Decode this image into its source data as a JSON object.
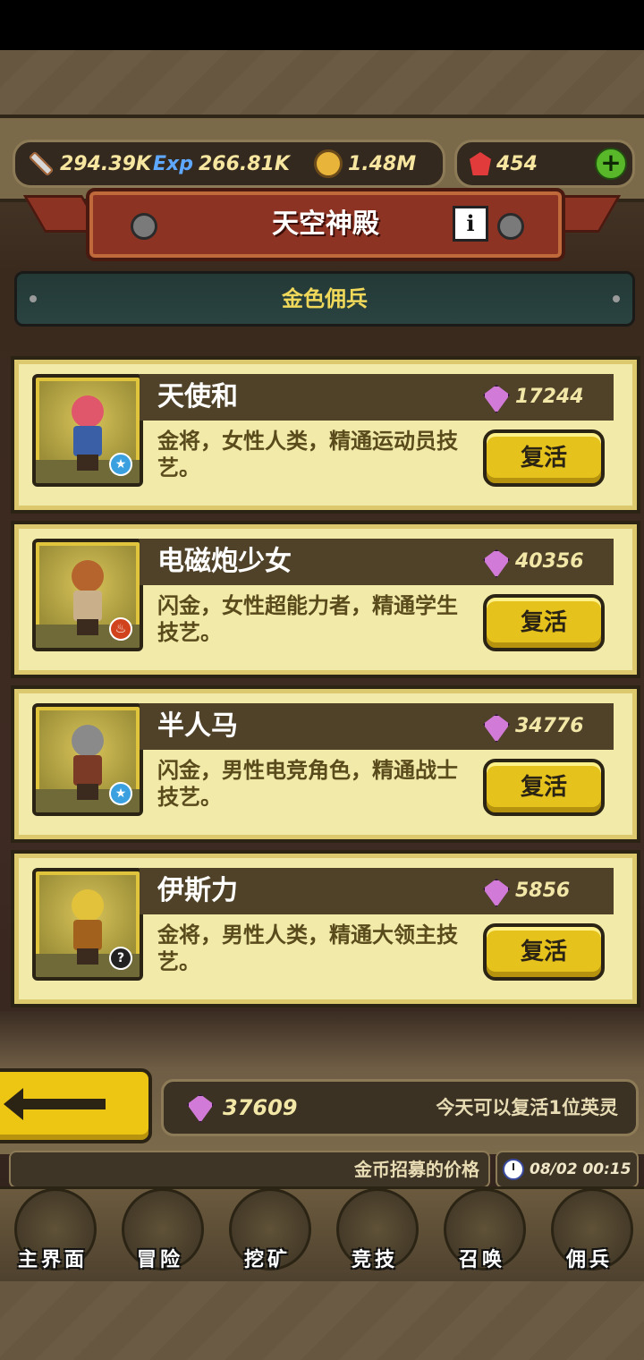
{
  "resources": {
    "power": "294.39K",
    "exp": "266.81K",
    "gold": "1.48M",
    "rubies": "454",
    "exp_icon_text": "Exp"
  },
  "header": {
    "title": "天空神殿",
    "info_label": "i"
  },
  "category": "金色佣兵",
  "heroes": [
    {
      "name": "天使和",
      "price": "17244",
      "desc": "金将，女性人类，精通运动员技艺。",
      "action": "复活",
      "badge": "★",
      "hair": "#e0566a",
      "outfit": "#3b5fa6",
      "badge_color": "#3aa0e0"
    },
    {
      "name": "电磁炮少女",
      "price": "40356",
      "desc": "闪金，女性超能力者，精通学生技艺。",
      "action": "复活",
      "badge": "♨",
      "hair": "#b4642c",
      "outfit": "#c9b08a",
      "badge_color": "#d0431d"
    },
    {
      "name": "半人马",
      "price": "34776",
      "desc": "闪金，男性电竞角色，精通战士技艺。",
      "action": "复活",
      "badge": "★",
      "hair": "#8a8a8a",
      "outfit": "#7a3a26",
      "badge_color": "#3aa0e0"
    },
    {
      "name": "伊斯力",
      "price": "5856",
      "desc": "金将，男性人类，精通大领主技艺。",
      "action": "复活",
      "badge": "?",
      "hair": "#e2c23a",
      "outfit": "#a2621e",
      "badge_color": "#222222"
    }
  ],
  "footer": {
    "gems": "37609",
    "note": "今天可以复活1位英灵"
  },
  "ticker": "金币招募的价格",
  "clock": "08/02 00:15",
  "nav": [
    {
      "label": "主界面",
      "icon": "scroll-map-icon"
    },
    {
      "label": "冒险",
      "icon": "island-icon"
    },
    {
      "label": "挖矿",
      "icon": "pickaxe-icon"
    },
    {
      "label": "竞技",
      "icon": "crossed-swords-icon"
    },
    {
      "label": "召唤",
      "icon": "summon-scroll-icon"
    },
    {
      "label": "佣兵",
      "icon": "tent-icon"
    }
  ]
}
